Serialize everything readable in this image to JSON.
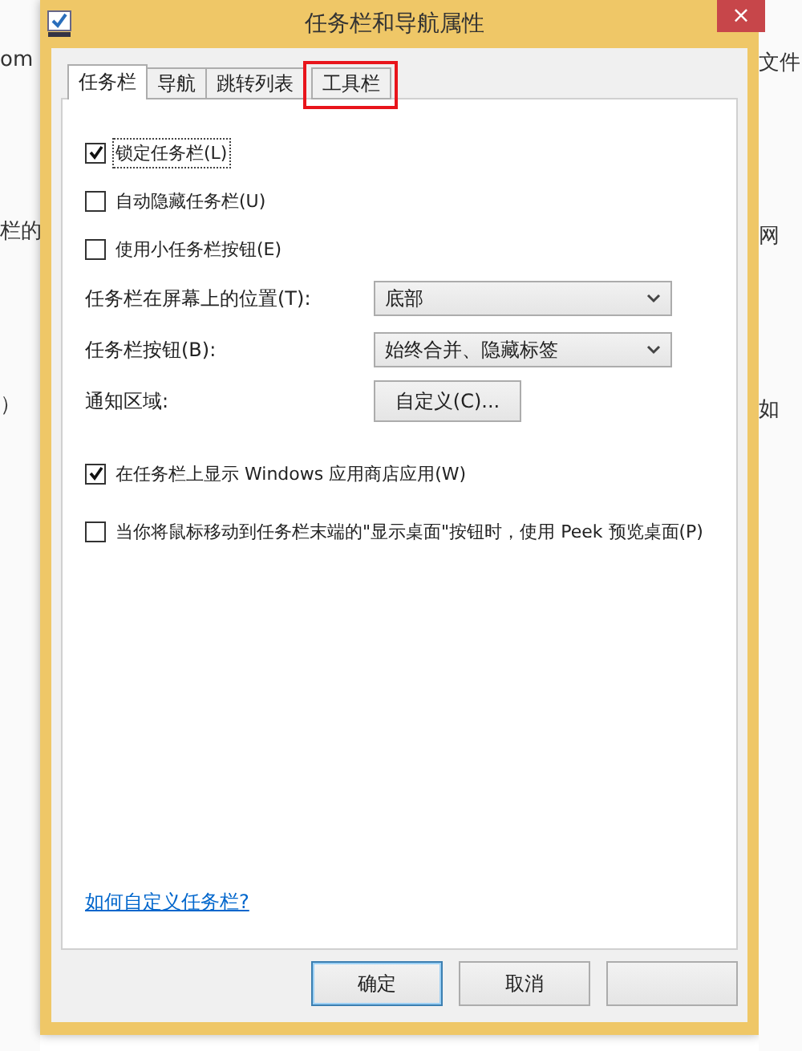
{
  "background": {
    "left_texts": [
      "om",
      "栏的",
      "）"
    ],
    "right_texts": [
      "文件",
      "网",
      "如"
    ]
  },
  "window": {
    "title": "任务栏和导航属性",
    "close": "×"
  },
  "tabs": [
    {
      "label": "任务栏",
      "selected": true,
      "highlighted": false
    },
    {
      "label": "导航",
      "selected": false,
      "highlighted": false
    },
    {
      "label": "跳转列表",
      "selected": false,
      "highlighted": false
    },
    {
      "label": "工具栏",
      "selected": false,
      "highlighted": true
    }
  ],
  "options": [
    {
      "kind": "checkbox",
      "label": "锁定任务栏(L)",
      "checked": true,
      "focused": true
    },
    {
      "kind": "checkbox",
      "label": "自动隐藏任务栏(U)",
      "checked": false,
      "focused": false
    },
    {
      "kind": "checkbox",
      "label": "使用小任务栏按钮(E)",
      "checked": false,
      "focused": false
    },
    {
      "kind": "select",
      "label": "任务栏在屏幕上的位置(T):",
      "value": "底部"
    },
    {
      "kind": "select",
      "label": "任务栏按钮(B):",
      "value": "始终合并、隐藏标签"
    },
    {
      "kind": "button",
      "label": "通知区域:",
      "value": "自定义(C)..."
    },
    {
      "kind": "checkbox",
      "label": "在任务栏上显示 Windows 应用商店应用(W)",
      "checked": true,
      "focused": false
    },
    {
      "kind": "checkbox",
      "label": "当你将鼠标移动到任务栏末端的\"显示桌面\"按钮时，使用 Peek 预览桌面(P)",
      "checked": false,
      "focused": false
    }
  ],
  "help_link": "如何自定义任务栏?",
  "buttons": [
    {
      "label": "确定",
      "default": true
    },
    {
      "label": "取消",
      "default": false
    },
    {
      "default": false
    }
  ]
}
